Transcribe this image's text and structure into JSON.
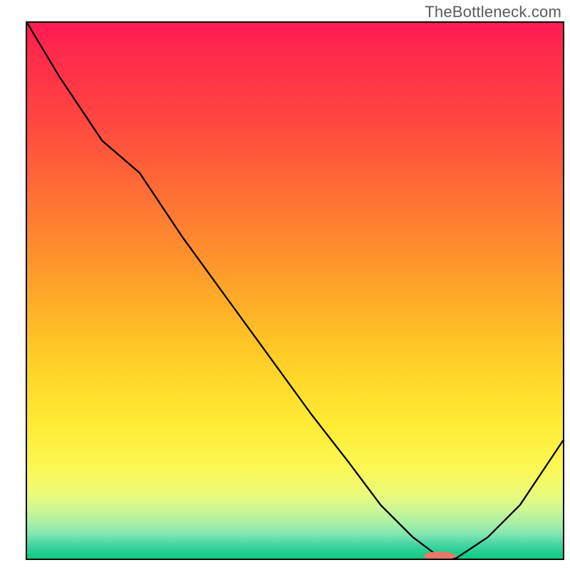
{
  "watermark": "TheBottleneck.com",
  "colors": {
    "border": "#000000",
    "curve_stroke": "#000000",
    "marker": "#e9766a",
    "gradient_stops": [
      "#ff1a52",
      "#ff2b4c",
      "#ff4640",
      "#ff6f35",
      "#ff962c",
      "#ffb927",
      "#ffd728",
      "#ffeb35",
      "#fbf853",
      "#ebfa7a",
      "#cbf695",
      "#a7efa8",
      "#7fe6b2",
      "#4fd7a7",
      "#29cf93",
      "#0ccb80"
    ]
  },
  "chart_data": {
    "type": "line",
    "title": "",
    "xlabel": "",
    "ylabel": "",
    "xlim": [
      0,
      100
    ],
    "ylim": [
      0,
      100
    ],
    "x": [
      0,
      6,
      14,
      21,
      29,
      37,
      45,
      53,
      60,
      66,
      72,
      76,
      80,
      86,
      92,
      100
    ],
    "values": [
      100,
      90,
      78,
      72,
      60,
      49,
      38,
      27,
      18,
      10,
      4,
      1,
      0,
      4,
      10,
      22
    ],
    "marker_center_x_pct": 77,
    "marker_y_pct": 0.5,
    "marker_radius_x_pct": 3,
    "marker_radius_y_pct": 0.8,
    "notes": "Values are read as percent of plot height from bottom; x as percent of plot width from left. No axis ticks or labels are visible."
  }
}
